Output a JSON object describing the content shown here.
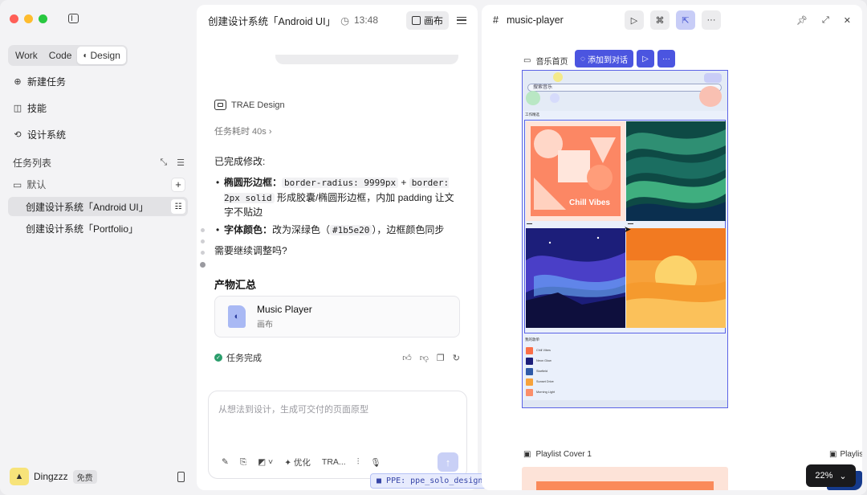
{
  "sidebar": {
    "mode_tabs": [
      "Work",
      "Code",
      "Design"
    ],
    "active_mode": "Design",
    "nav": [
      {
        "label": "新建任务",
        "icon": "new-task-icon"
      },
      {
        "label": "技能",
        "icon": "skills-icon"
      },
      {
        "label": "设计系统",
        "icon": "design-system-icon"
      }
    ],
    "task_list_title": "任务列表",
    "group_name": "默认",
    "tasks": [
      {
        "label": "创建设计系统「Android UI」",
        "active": true
      },
      {
        "label": "创建设计系统「Portfolio」",
        "active": false
      }
    ],
    "user": {
      "name": "Dingzzz",
      "plan": "免费"
    }
  },
  "chat": {
    "title": "创建设计系统「Android UI」",
    "time": "13:48",
    "canvas_button": "画布",
    "agent_name": "TRAE Design",
    "task_duration": "任务耗时 40s",
    "done_intro": "已完成修改:",
    "bullet1_label": "椭圆形边框：",
    "bullet1_code1": "border-radius: 9999px",
    "bullet1_plus": " + ",
    "bullet1_code2": "border: 2px solid",
    "bullet1_rest": " 形成胶囊/椭圆形边框，内加 padding 让文字不贴边",
    "bullet2_label": "字体颜色：",
    "bullet2_pre": "改为深绿色（",
    "bullet2_code": "#1b5e20",
    "bullet2_post": "），边框颜色同步",
    "question": "需要继续调整吗?",
    "artifacts_title": "产物汇总",
    "artifact": {
      "name": "Music Player",
      "type": "画布"
    },
    "task_done": "任务完成",
    "composer_placeholder": "从想法到设计，生成可交付的页面原型",
    "tool_optimize": "优化",
    "tool_model": "TRA...",
    "ppe_tag": "PPE: ppe_solo_design"
  },
  "canvas": {
    "title": "music-player",
    "frame_label": "音乐首页",
    "add_to_chat": "添加到对话",
    "artboard": {
      "search_text": "搜索音乐",
      "section_title": "工作精选",
      "tile1_text": "Chill Vibes",
      "list_title": "我的歌单",
      "list_items": [
        "Chill Vibes",
        "Neon Glow",
        "Starfield",
        "Sunset Drive",
        "Morning Light"
      ]
    },
    "frame2_label": "Playlist Cover 1",
    "frame3_label": "Playlis",
    "zoom": "22%"
  },
  "colors": {
    "accent": "#4b55e0",
    "selection": "#5b63e6",
    "success": "#2a9d6b"
  }
}
